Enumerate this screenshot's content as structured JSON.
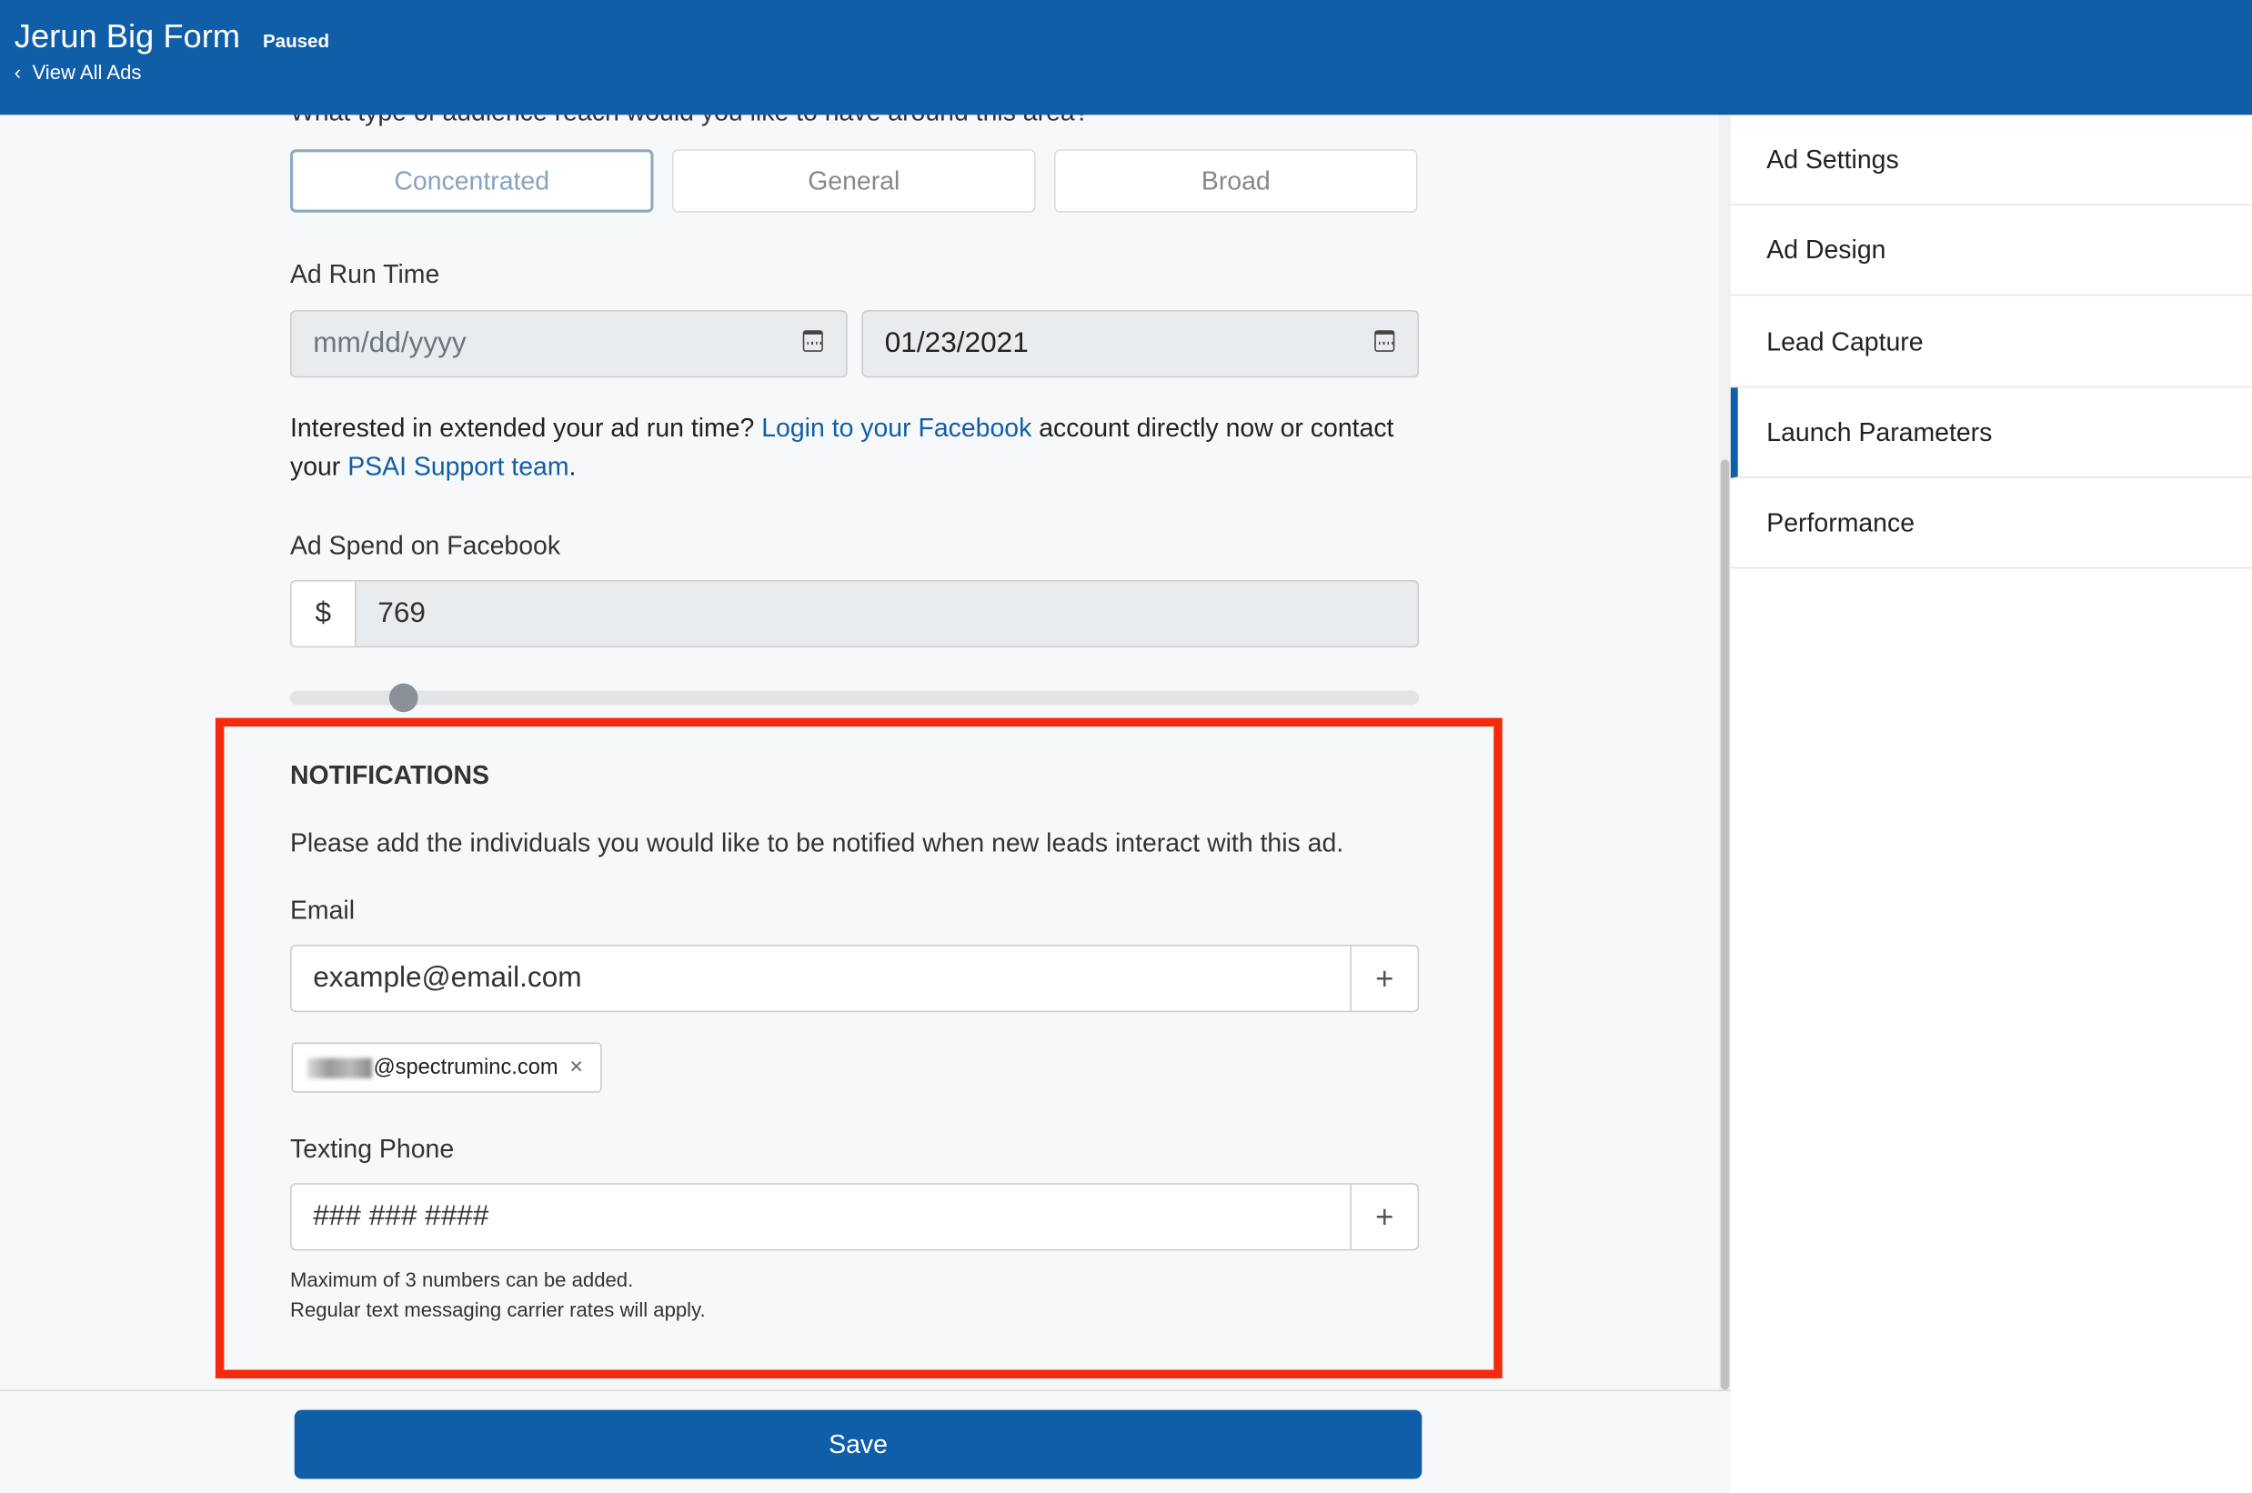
{
  "header": {
    "title": "Jerun Big Form",
    "status": "Paused",
    "back_label": "View All Ads"
  },
  "audience": {
    "question": "What type of audience reach would you like to have around this area?",
    "options": [
      "Concentrated",
      "General",
      "Broad"
    ],
    "selected": "Concentrated"
  },
  "run_time": {
    "label": "Ad Run Time",
    "start_placeholder": "mm/dd/yyyy",
    "end_value": "01/23/2021"
  },
  "extend": {
    "text1": "Interested in extended your ad run time? ",
    "link1": "Login to your Facebook",
    "text2": " account directly now or contact your ",
    "link2": "PSAI Support team",
    "text3": "."
  },
  "spend": {
    "label": "Ad Spend on Facebook",
    "currency": "$",
    "value": "769",
    "slider_fraction": 0.1
  },
  "notifications": {
    "heading": "NOTIFICATIONS",
    "description": "Please add the individuals you would like to be notified when new leads interact with this ad.",
    "email_label": "Email",
    "email_placeholder": "example@email.com",
    "email_chip": "@spectruminc.com",
    "phone_label": "Texting Phone",
    "phone_placeholder": "### ### ####",
    "note1": "Maximum of 3 numbers can be added.",
    "note2": "Regular text messaging carrier rates will apply."
  },
  "sidebar": {
    "items": [
      {
        "label": "Ad Settings"
      },
      {
        "label": "Ad Design"
      },
      {
        "label": "Lead Capture"
      },
      {
        "label": "Launch Parameters",
        "active": true
      },
      {
        "label": "Performance"
      }
    ]
  },
  "footer": {
    "save_label": "Save"
  },
  "colors": {
    "primary": "#115ea8",
    "highlight": "#f52a0c"
  }
}
